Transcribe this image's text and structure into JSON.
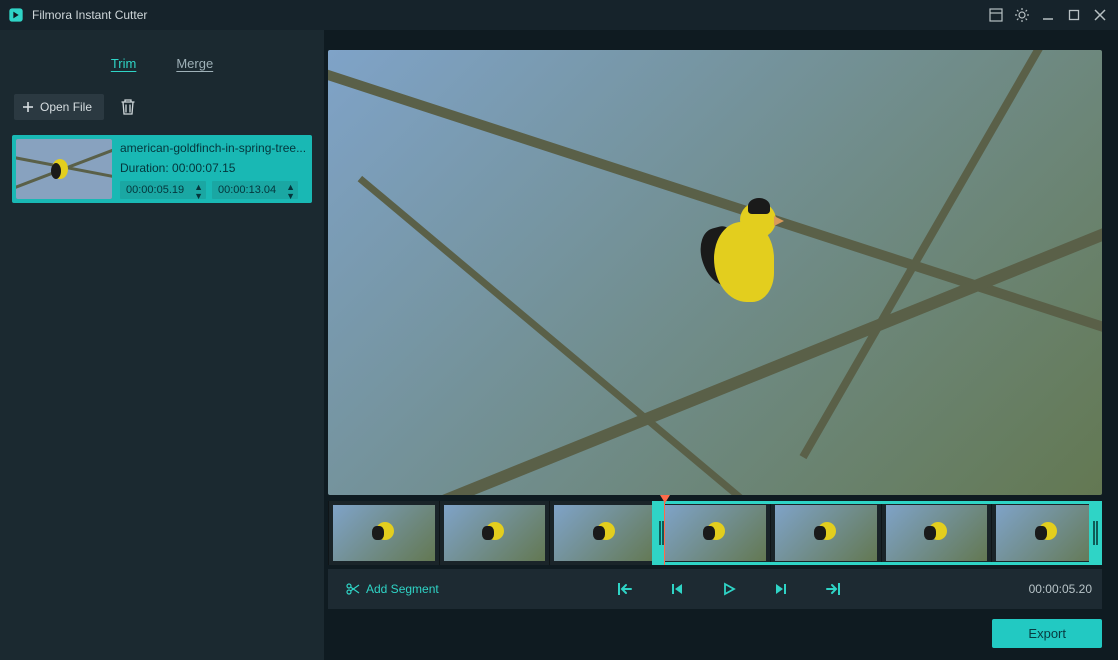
{
  "titlebar": {
    "app_title": "Filmora Instant Cutter"
  },
  "sidebar": {
    "tabs": {
      "trim": "Trim",
      "merge": "Merge"
    },
    "open_file_label": "Open File",
    "clip": {
      "filename": "american-goldfinch-in-spring-tree...",
      "duration_label": "Duration: 00:00:07.15",
      "in_tc": "00:00:05.19",
      "out_tc": "00:00:13.04"
    }
  },
  "controls": {
    "add_segment_label": "Add Segment",
    "time_readout": "00:00:05.20"
  },
  "footer": {
    "export_label": "Export"
  }
}
